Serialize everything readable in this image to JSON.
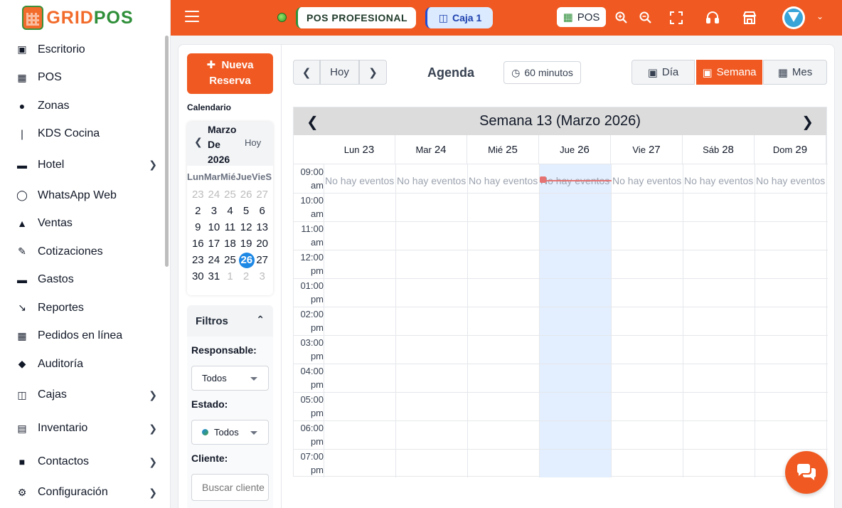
{
  "brand": {
    "name_a": "GRID",
    "name_b": "POS"
  },
  "sidebar": {
    "items": [
      {
        "label": "Escritorio",
        "icon": "desktop-icon",
        "chevron": false
      },
      {
        "label": "POS",
        "icon": "register-icon",
        "chevron": false
      },
      {
        "label": "Zonas",
        "icon": "map-pin-icon",
        "chevron": false
      },
      {
        "label": "KDS Cocina",
        "icon": "utensils-icon",
        "chevron": false
      },
      {
        "label": "Hotel",
        "icon": "bed-icon",
        "chevron": true
      },
      {
        "label": "WhatsApp Web",
        "icon": "whatsapp-icon",
        "chevron": false
      },
      {
        "label": "Ventas",
        "icon": "sales-chart-icon",
        "chevron": false
      },
      {
        "label": "Cotizaciones",
        "icon": "file-edit-icon",
        "chevron": false
      },
      {
        "label": "Gastos",
        "icon": "money-icon",
        "chevron": false
      },
      {
        "label": "Reportes",
        "icon": "line-chart-icon",
        "chevron": false
      },
      {
        "label": "Pedidos en línea",
        "icon": "store-icon",
        "chevron": false
      },
      {
        "label": "Auditoría",
        "icon": "shield-icon",
        "chevron": false
      },
      {
        "label": "Cajas",
        "icon": "cash-register-icon",
        "chevron": true
      },
      {
        "label": "Inventario",
        "icon": "clipboard-icon",
        "chevron": true
      },
      {
        "label": "Contactos",
        "icon": "contacts-icon",
        "chevron": true
      },
      {
        "label": "Configuración",
        "icon": "gear-icon",
        "chevron": true
      }
    ]
  },
  "topbar": {
    "plan_label": "POS PROFESIONAL",
    "caja_label": "Caja 1",
    "pos_button": "POS"
  },
  "agenda": {
    "new_button_line1": "Nueva",
    "new_button_line2": "Reserva",
    "calendar_label": "Calendario",
    "mini_month_line1": "Marzo",
    "mini_month_line2": "De",
    "mini_month_line3": "2026",
    "mini_today": "Hoy",
    "mini_dow": [
      "Lun",
      "Mar",
      "Mié",
      "Jue",
      "Vie",
      "S"
    ],
    "mini_weeks": [
      [
        {
          "d": "23",
          "m": true
        },
        {
          "d": "24",
          "m": true
        },
        {
          "d": "25",
          "m": true
        },
        {
          "d": "26",
          "m": true
        },
        {
          "d": "27",
          "m": true
        }
      ],
      [
        {
          "d": "2"
        },
        {
          "d": "3"
        },
        {
          "d": "4"
        },
        {
          "d": "5"
        },
        {
          "d": "6"
        }
      ],
      [
        {
          "d": "9"
        },
        {
          "d": "10"
        },
        {
          "d": "11"
        },
        {
          "d": "12"
        },
        {
          "d": "13"
        }
      ],
      [
        {
          "d": "16"
        },
        {
          "d": "17"
        },
        {
          "d": "18"
        },
        {
          "d": "19"
        },
        {
          "d": "20"
        }
      ],
      [
        {
          "d": "23"
        },
        {
          "d": "24"
        },
        {
          "d": "25"
        },
        {
          "d": "26",
          "t": true
        },
        {
          "d": "27"
        }
      ],
      [
        {
          "d": "30"
        },
        {
          "d": "31"
        },
        {
          "d": "1",
          "m": true
        },
        {
          "d": "2",
          "m": true
        },
        {
          "d": "3",
          "m": true
        }
      ]
    ],
    "filters_title": "Filtros",
    "responsable_label": "Responsable:",
    "responsable_value": "Todos",
    "estado_label": "Estado:",
    "estado_value": "Todos",
    "cliente_label": "Cliente:",
    "cliente_placeholder": "Buscar cliente",
    "today_btn": "Hoy",
    "title": "Agenda",
    "interval": "60 minutos",
    "view_day": "Día",
    "view_week": "Semana",
    "view_month": "Mes",
    "week_title": "Semana 13 (Marzo 2026)",
    "days": [
      {
        "name": "Lun",
        "num": "23"
      },
      {
        "name": "Mar",
        "num": "24"
      },
      {
        "name": "Mié",
        "num": "25"
      },
      {
        "name": "Jue",
        "num": "26"
      },
      {
        "name": "Vie",
        "num": "27"
      },
      {
        "name": "Sáb",
        "num": "28"
      },
      {
        "name": "Dom",
        "num": "29"
      }
    ],
    "times": [
      {
        "h": "09:00",
        "p": "am"
      },
      {
        "h": "10:00",
        "p": "am"
      },
      {
        "h": "11:00",
        "p": "am"
      },
      {
        "h": "12:00",
        "p": "pm"
      },
      {
        "h": "01:00",
        "p": "pm"
      },
      {
        "h": "02:00",
        "p": "pm"
      },
      {
        "h": "03:00",
        "p": "pm"
      },
      {
        "h": "04:00",
        "p": "pm"
      },
      {
        "h": "05:00",
        "p": "pm"
      },
      {
        "h": "06:00",
        "p": "pm"
      },
      {
        "h": "07:00",
        "p": "pm"
      }
    ],
    "no_events": "No hay eventos"
  },
  "colors": {
    "accent": "#f05a22",
    "today_highlight": "#e3efff",
    "brand_green": "#2f8f3a"
  }
}
